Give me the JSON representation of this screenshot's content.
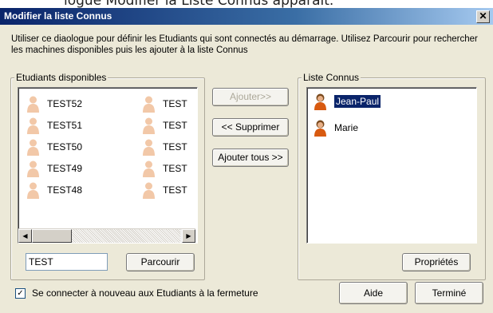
{
  "caption": "logue Modifier la Liste Connus apparaît.",
  "dialog": {
    "title": "Modifier la liste Connus",
    "close_label": "✕",
    "description": "Utiliser ce diaologue pour définir les Etudiants qui sont connectés au démarrage. Utilisez Parcourir pour rechercher les machines disponibles puis les ajouter à la liste Connus"
  },
  "available": {
    "legend": "Etudiants disponibles",
    "col1": [
      "TEST52",
      "TEST51",
      "TEST50",
      "TEST49",
      "TEST48"
    ],
    "col2": [
      "TEST",
      "TEST",
      "TEST",
      "TEST",
      "TEST"
    ],
    "scroll_left": "◀",
    "scroll_right": "▶",
    "search_value": "TEST",
    "browse_label": "Parcourir"
  },
  "middle": {
    "add_label": "Ajouter>>",
    "remove_label": "<< Supprimer",
    "add_all_label": "Ajouter tous >>"
  },
  "known": {
    "legend": "Liste Connus",
    "items": [
      "Jean-Paul",
      "Marie"
    ],
    "selected_index": 0,
    "properties_label": "Propriétés"
  },
  "footer": {
    "reconnect_checked": true,
    "checkmark": "✓",
    "reconnect_label": "Se connecter à nouveau aux Etudiants à la fermeture",
    "help_label": "Aide",
    "done_label": "Terminé"
  },
  "icons": {
    "student": "student-icon",
    "person": "person-icon"
  },
  "colors": {
    "dialog_bg": "#ece9d8",
    "title_start": "#0a246a",
    "selection": "#0a246a"
  }
}
